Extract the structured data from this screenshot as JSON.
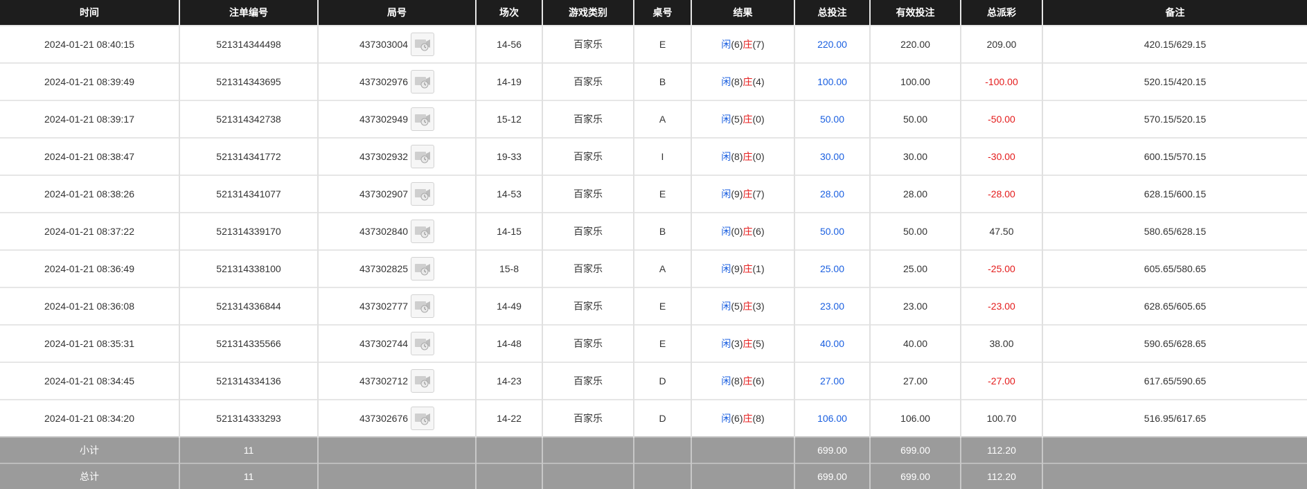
{
  "headers": [
    "时间",
    "注单编号",
    "局号",
    "场次",
    "游戏类别",
    "桌号",
    "结果",
    "总投注",
    "有效投注",
    "总派彩",
    "备注"
  ],
  "result_labels": {
    "player": "闲",
    "banker": "庄"
  },
  "rows": [
    {
      "time": "2024-01-21 08:40:15",
      "bet_no": "521314344498",
      "round_no": "437303004",
      "session": "14-56",
      "game": "百家乐",
      "table": "E",
      "player": "(6)",
      "banker": "(7)",
      "total_bet": "220.00",
      "valid_bet": "220.00",
      "payout": "209.00",
      "payout_color": "black",
      "note": "420.15/629.15"
    },
    {
      "time": "2024-01-21 08:39:49",
      "bet_no": "521314343695",
      "round_no": "437302976",
      "session": "14-19",
      "game": "百家乐",
      "table": "B",
      "player": "(8)",
      "banker": "(4)",
      "total_bet": "100.00",
      "valid_bet": "100.00",
      "payout": "-100.00",
      "payout_color": "red",
      "note": "520.15/420.15"
    },
    {
      "time": "2024-01-21 08:39:17",
      "bet_no": "521314342738",
      "round_no": "437302949",
      "session": "15-12",
      "game": "百家乐",
      "table": "A",
      "player": "(5)",
      "banker": "(0)",
      "total_bet": "50.00",
      "valid_bet": "50.00",
      "payout": "-50.00",
      "payout_color": "red",
      "note": "570.15/520.15"
    },
    {
      "time": "2024-01-21 08:38:47",
      "bet_no": "521314341772",
      "round_no": "437302932",
      "session": "19-33",
      "game": "百家乐",
      "table": "I",
      "player": "(8)",
      "banker": "(0)",
      "total_bet": "30.00",
      "valid_bet": "30.00",
      "payout": "-30.00",
      "payout_color": "red",
      "note": "600.15/570.15"
    },
    {
      "time": "2024-01-21 08:38:26",
      "bet_no": "521314341077",
      "round_no": "437302907",
      "session": "14-53",
      "game": "百家乐",
      "table": "E",
      "player": "(9)",
      "banker": "(7)",
      "total_bet": "28.00",
      "valid_bet": "28.00",
      "payout": "-28.00",
      "payout_color": "red",
      "note": "628.15/600.15"
    },
    {
      "time": "2024-01-21 08:37:22",
      "bet_no": "521314339170",
      "round_no": "437302840",
      "session": "14-15",
      "game": "百家乐",
      "table": "B",
      "player": "(0)",
      "banker": "(6)",
      "total_bet": "50.00",
      "valid_bet": "50.00",
      "payout": "47.50",
      "payout_color": "black",
      "note": "580.65/628.15"
    },
    {
      "time": "2024-01-21 08:36:49",
      "bet_no": "521314338100",
      "round_no": "437302825",
      "session": "15-8",
      "game": "百家乐",
      "table": "A",
      "player": "(9)",
      "banker": "(1)",
      "total_bet": "25.00",
      "valid_bet": "25.00",
      "payout": "-25.00",
      "payout_color": "red",
      "note": "605.65/580.65"
    },
    {
      "time": "2024-01-21 08:36:08",
      "bet_no": "521314336844",
      "round_no": "437302777",
      "session": "14-49",
      "game": "百家乐",
      "table": "E",
      "player": "(5)",
      "banker": "(3)",
      "total_bet": "23.00",
      "valid_bet": "23.00",
      "payout": "-23.00",
      "payout_color": "red",
      "note": "628.65/605.65"
    },
    {
      "time": "2024-01-21 08:35:31",
      "bet_no": "521314335566",
      "round_no": "437302744",
      "session": "14-48",
      "game": "百家乐",
      "table": "E",
      "player": "(3)",
      "banker": "(5)",
      "total_bet": "40.00",
      "valid_bet": "40.00",
      "payout": "38.00",
      "payout_color": "black",
      "note": "590.65/628.65"
    },
    {
      "time": "2024-01-21 08:34:45",
      "bet_no": "521314334136",
      "round_no": "437302712",
      "session": "14-23",
      "game": "百家乐",
      "table": "D",
      "player": "(8)",
      "banker": "(6)",
      "total_bet": "27.00",
      "valid_bet": "27.00",
      "payout": "-27.00",
      "payout_color": "red",
      "note": "617.65/590.65"
    },
    {
      "time": "2024-01-21 08:34:20",
      "bet_no": "521314333293",
      "round_no": "437302676",
      "session": "14-22",
      "game": "百家乐",
      "table": "D",
      "player": "(6)",
      "banker": "(8)",
      "total_bet": "106.00",
      "valid_bet": "106.00",
      "payout": "100.70",
      "payout_color": "black",
      "note": "516.95/617.65"
    }
  ],
  "subtotal": {
    "label": "小计",
    "count": "11",
    "total_bet": "699.00",
    "valid_bet": "699.00",
    "payout": "112.20"
  },
  "total": {
    "label": "总计",
    "count": "11",
    "total_bet": "699.00",
    "valid_bet": "699.00",
    "payout": "112.20"
  },
  "colors": {
    "header_bg": "#1d1d1d",
    "summary_bg": "#9b9b9b",
    "blue": "#1a5fe0",
    "red": "#e41b1b"
  },
  "icons": {
    "round_record": "video-record-icon"
  }
}
